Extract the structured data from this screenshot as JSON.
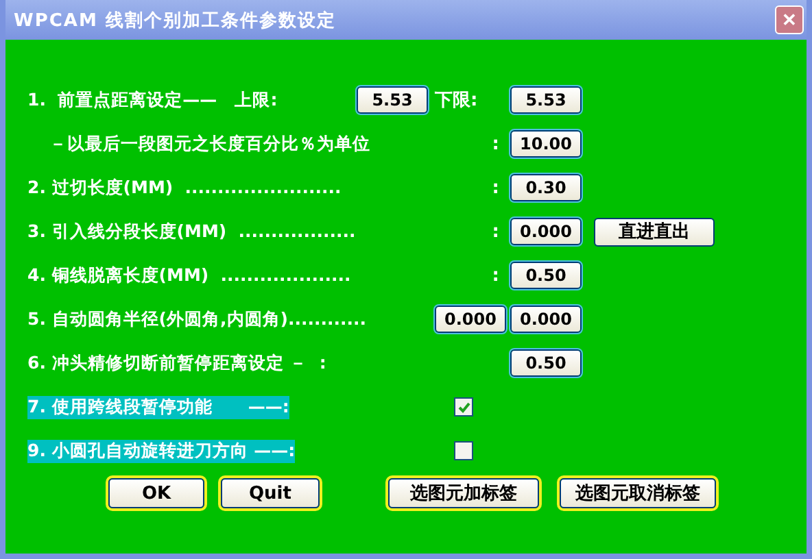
{
  "window": {
    "title": "WPCAM 线割个别加工条件参数设定",
    "close": "✕"
  },
  "rows": [
    {
      "kind": "limits",
      "label": "1.  前置点距离设定——   上限:",
      "sublabel": "下限:",
      "values": [
        "5.53",
        "5.53"
      ]
    },
    {
      "kind": "value",
      "indented": true,
      "label": "－以最后一段图元之长度百分比％为单位",
      "colon": ":",
      "values": [
        "10.00"
      ]
    },
    {
      "kind": "value",
      "label": "2. 过切长度(MM)  ........................",
      "colon": ":",
      "values": [
        "0.30"
      ]
    },
    {
      "kind": "value",
      "label": "3. 引入线分段长度(MM)  ..................",
      "colon": ":",
      "values": [
        "0.000"
      ],
      "button": "直进直出"
    },
    {
      "kind": "value",
      "label": "4. 铜线脱离长度(MM)  ....................",
      "colon": ":",
      "values": [
        "0.50"
      ]
    },
    {
      "kind": "pair",
      "label": "5. 自动圆角半径(外圆角,内圆角)............",
      "values": [
        "0.000",
        "0.000"
      ]
    },
    {
      "kind": "value",
      "label": "6. 冲头精修切断前暂停距离设定 －  :",
      "values": [
        "0.50"
      ]
    },
    {
      "kind": "check",
      "label": "7. 使用跨线段暂停功能      ——:",
      "checked": true
    },
    {
      "kind": "check",
      "label": "9. 小圆孔自动旋转进刀方向 ——:",
      "checked": false
    }
  ],
  "buttons": [
    "OK",
    "Quit",
    "选图元加标签",
    "选图元取消标签"
  ]
}
